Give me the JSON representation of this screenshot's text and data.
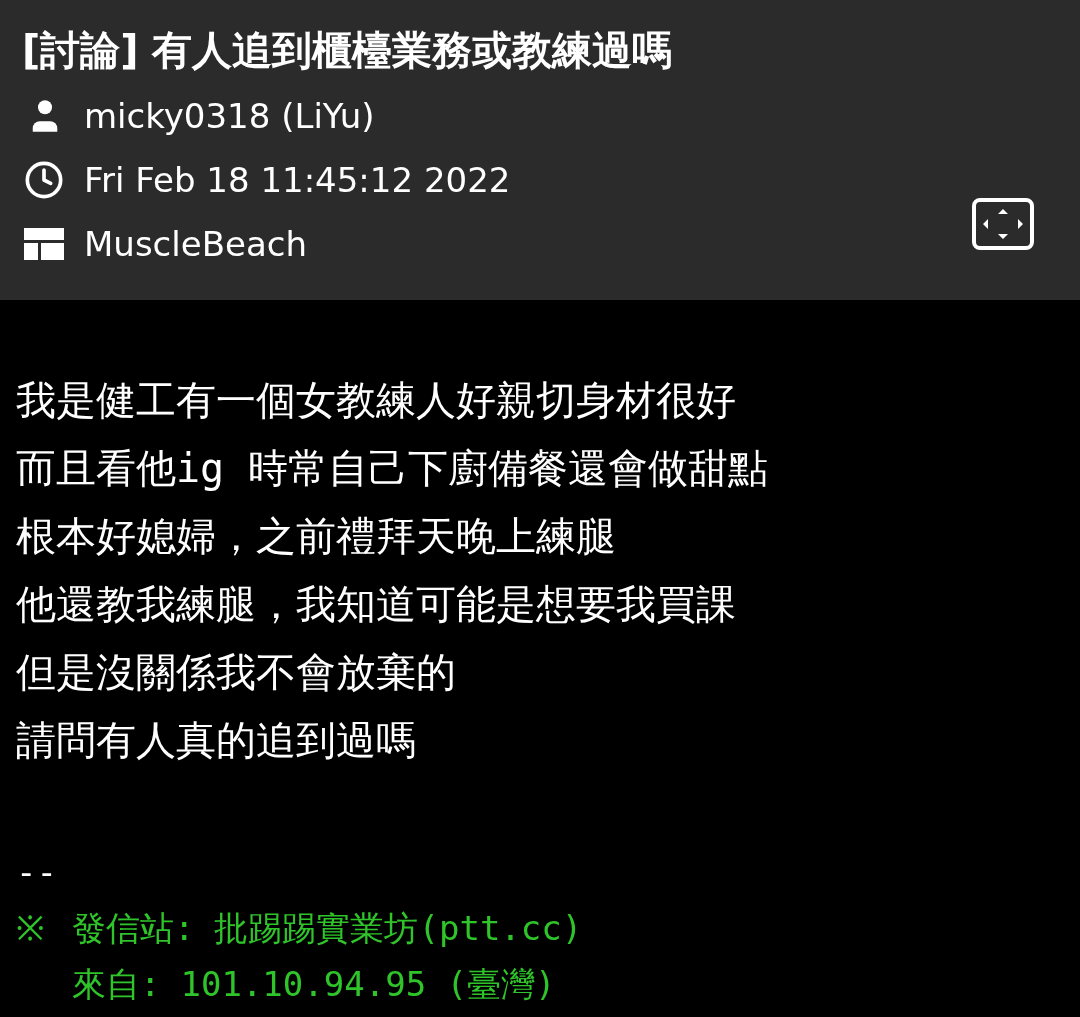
{
  "header": {
    "title": "[討論] 有人追到櫃檯業務或教練過嗎",
    "meta": [
      {
        "kind": "author",
        "text": "micky0318 (LiYu)"
      },
      {
        "kind": "time",
        "text": "Fri Feb 18 11:45:12 2022"
      },
      {
        "kind": "board",
        "text": "MuscleBeach"
      }
    ]
  },
  "body": {
    "lines": [
      "我是健工有一個女教練人好親切身材很好",
      "而且看他ig 時常自己下廚備餐還會做甜點",
      "根本好媳婦，之前禮拜天晚上練腿",
      "他還教我練腿，我知道可能是想要我買課",
      "但是沒關係我不會放棄的",
      "請問有人真的追到過嗎"
    ],
    "separator": "--",
    "footer": [
      {
        "mark": "※",
        "label": "發信站:",
        "value": "批踢踢實業坊(ptt.cc)"
      },
      {
        "label": "來自:",
        "value": "101.10.94.95 (臺灣)"
      }
    ]
  }
}
